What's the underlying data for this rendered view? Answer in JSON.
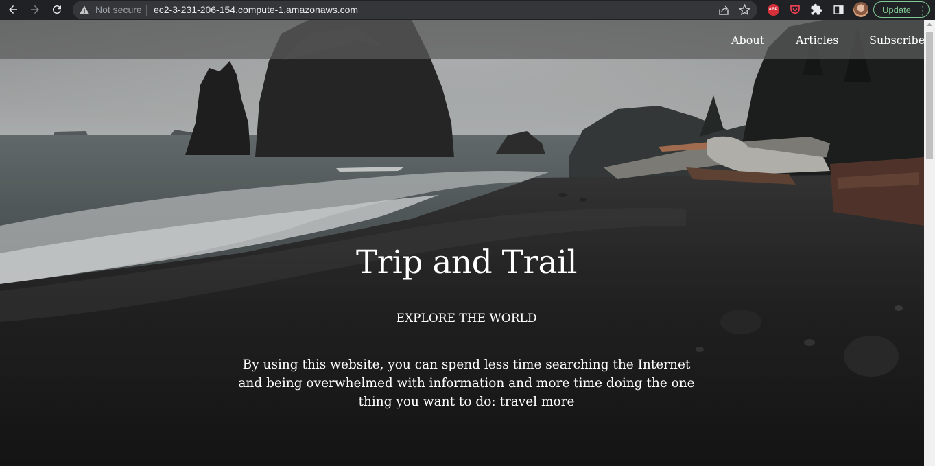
{
  "browser": {
    "security_label": "Not secure",
    "url": "ec2-3-231-206-154.compute-1.amazonaws.com",
    "update_label": "Update",
    "abp_label": "ABP",
    "icons": [
      "back-icon",
      "forward-icon",
      "reload-icon",
      "warning-icon",
      "share-icon",
      "star-icon",
      "adblock-plus-icon",
      "pocket-icon",
      "extensions-icon",
      "side-panel-icon",
      "profile-avatar",
      "more-icon"
    ],
    "accent_color": "#81c995"
  },
  "site": {
    "nav": {
      "about": "About",
      "articles": "Articles",
      "subscribe": "Subscribe"
    },
    "hero": {
      "title": "Trip and Trail",
      "subtitle": "EXPLORE THE WORLD",
      "description": "By using this website, you can spend less time searching the Internet and being overwhelmed with information and more time doing the one thing you want to do: travel more"
    },
    "background_image": "dark coastal beach with sea stacks and driftwood"
  }
}
